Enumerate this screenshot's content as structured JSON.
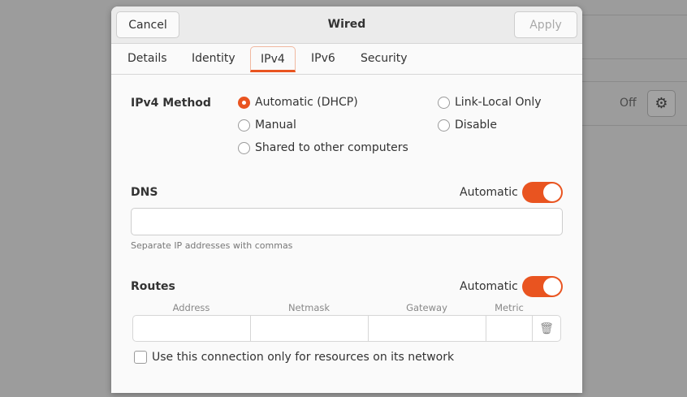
{
  "background": {
    "status_text": "Off"
  },
  "dialog": {
    "title": "Wired",
    "cancel_label": "Cancel",
    "apply_label": "Apply",
    "tabs": [
      {
        "label": "Details"
      },
      {
        "label": "Identity"
      },
      {
        "label": "IPv4"
      },
      {
        "label": "IPv6"
      },
      {
        "label": "Security"
      }
    ],
    "active_tab": "IPv4",
    "method": {
      "label": "IPv4 Method",
      "options": [
        {
          "label": "Automatic (DHCP)",
          "selected": true
        },
        {
          "label": "Manual",
          "selected": false
        },
        {
          "label": "Shared to other computers",
          "selected": false
        },
        {
          "label": "Link-Local Only",
          "selected": false
        },
        {
          "label": "Disable",
          "selected": false
        }
      ]
    },
    "dns": {
      "label": "DNS",
      "auto_label": "Automatic",
      "auto": true,
      "value": "",
      "hint": "Separate IP addresses with commas"
    },
    "routes": {
      "label": "Routes",
      "auto_label": "Automatic",
      "auto": true,
      "columns": [
        "Address",
        "Netmask",
        "Gateway",
        "Metric"
      ]
    },
    "only_local": {
      "label": "Use this connection only for resources on its network",
      "checked": false
    }
  },
  "colors": {
    "accent": "#e95420"
  }
}
